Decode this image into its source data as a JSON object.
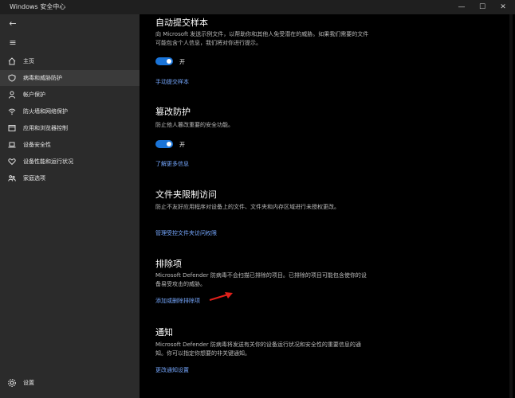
{
  "window": {
    "title": "Windows 安全中心"
  },
  "sidebar": {
    "items": [
      {
        "label": "主页",
        "icon": "home-icon"
      },
      {
        "label": "病毒和威胁防护",
        "icon": "shield-icon"
      },
      {
        "label": "帐户保护",
        "icon": "person-icon"
      },
      {
        "label": "防火墙和网络保护",
        "icon": "wifi-icon"
      },
      {
        "label": "应用和浏览器控制",
        "icon": "app-window-icon"
      },
      {
        "label": "设备安全性",
        "icon": "laptop-icon"
      },
      {
        "label": "设备性能和运行状况",
        "icon": "heart-icon"
      },
      {
        "label": "家庭选项",
        "icon": "family-icon"
      }
    ],
    "settings_label": "设置"
  },
  "content": {
    "auto_submit": {
      "title": "自动提交样本",
      "desc": "向 Microsoft 发送示例文件，以帮助你和其他人免受潜在的威胁。如果我们需要的文件可能包含个人信息，我们将对你进行提示。",
      "toggle_label": "开",
      "link": "手动提交样本"
    },
    "tamper": {
      "title": "篡改防护",
      "desc": "防止他人篡改重要的安全功能。",
      "toggle_label": "开",
      "link": "了解更多信息"
    },
    "folder_access": {
      "title": "文件夹限制访问",
      "desc": "防止不友好应用程序对设备上的文件、文件夹和内存区域进行未授权更改。",
      "link": "管理受控文件夹访问权限"
    },
    "exclusions": {
      "title": "排除项",
      "desc": "Microsoft Defender 防病毒不会扫描已排除的项目。已排除的项目可能包含使你的设备易受攻击的威胁。",
      "link": "添加或删除排除项"
    },
    "notifications": {
      "title": "通知",
      "desc": "Microsoft Defender 防病毒将发送有关你的设备运行状况和安全性的重要信息的通知。你可以指定你想要的非关键通知。",
      "link": "更改通知设置"
    }
  },
  "colors": {
    "accent": "#1a74d8",
    "link": "#76a8ff",
    "arrow": "#e0201b"
  }
}
